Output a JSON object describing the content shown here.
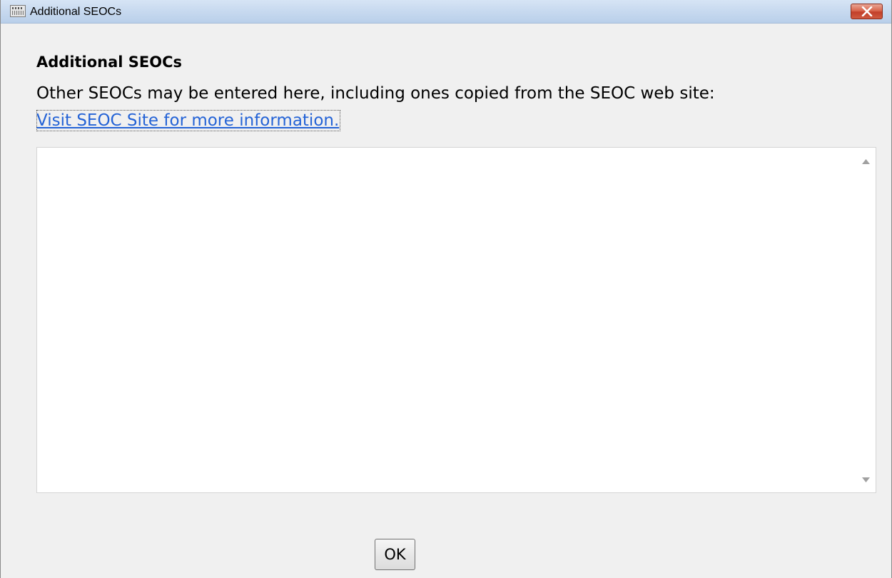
{
  "window": {
    "title": "Additional SEOCs",
    "app_icon": "app-window-icon",
    "close_icon": "close-x-icon"
  },
  "content": {
    "heading": "Additional SEOCs",
    "description": "Other SEOCs may be entered here, including ones copied from the SEOC web site:",
    "link_text": "Visit SEOC Site for more information."
  },
  "text_area": {
    "value": "",
    "scroll_up_icon": "scroll-up-arrow-icon",
    "scroll_down_icon": "scroll-down-arrow-icon"
  },
  "buttons": {
    "ok_label": "OK"
  },
  "colors": {
    "link": "#2463d6",
    "close_button": "#c9503a",
    "titlebar": "#c7d9ef"
  }
}
